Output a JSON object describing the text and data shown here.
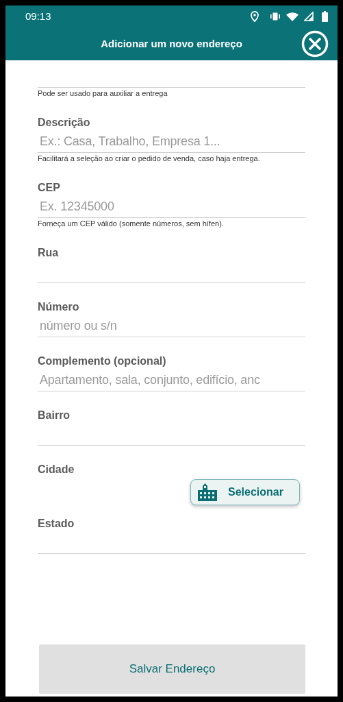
{
  "status_bar": {
    "time": "09:13"
  },
  "header": {
    "title": "Adicionar um novo endereço"
  },
  "fields": [
    {
      "kind": "partial",
      "help": "Pode ser usado para auxiliar a entrega"
    },
    {
      "kind": "text",
      "label": "Descrição",
      "placeholder": "Ex.: Casa, Trabalho, Empresa 1...",
      "help": "Facilitará a seleção ao criar o pedido de venda, caso haja entrega."
    },
    {
      "kind": "text",
      "label": "CEP",
      "placeholder": "Ex. 12345000",
      "help": "Forneça um CEP válido (somente números, sem hífen)."
    },
    {
      "kind": "text",
      "label": "Rua"
    },
    {
      "kind": "text",
      "label": "Número",
      "placeholder": "número ou s/n"
    },
    {
      "kind": "text",
      "label": "Complemento (opcional)",
      "placeholder": "Apartamento, sala, conjunto, edifício, anc"
    },
    {
      "kind": "text",
      "label": "Bairro"
    },
    {
      "kind": "select",
      "label": "Cidade",
      "button": "Selecionar"
    },
    {
      "kind": "text",
      "label": "Estado"
    }
  ],
  "save_button": "Salvar Endereço"
}
